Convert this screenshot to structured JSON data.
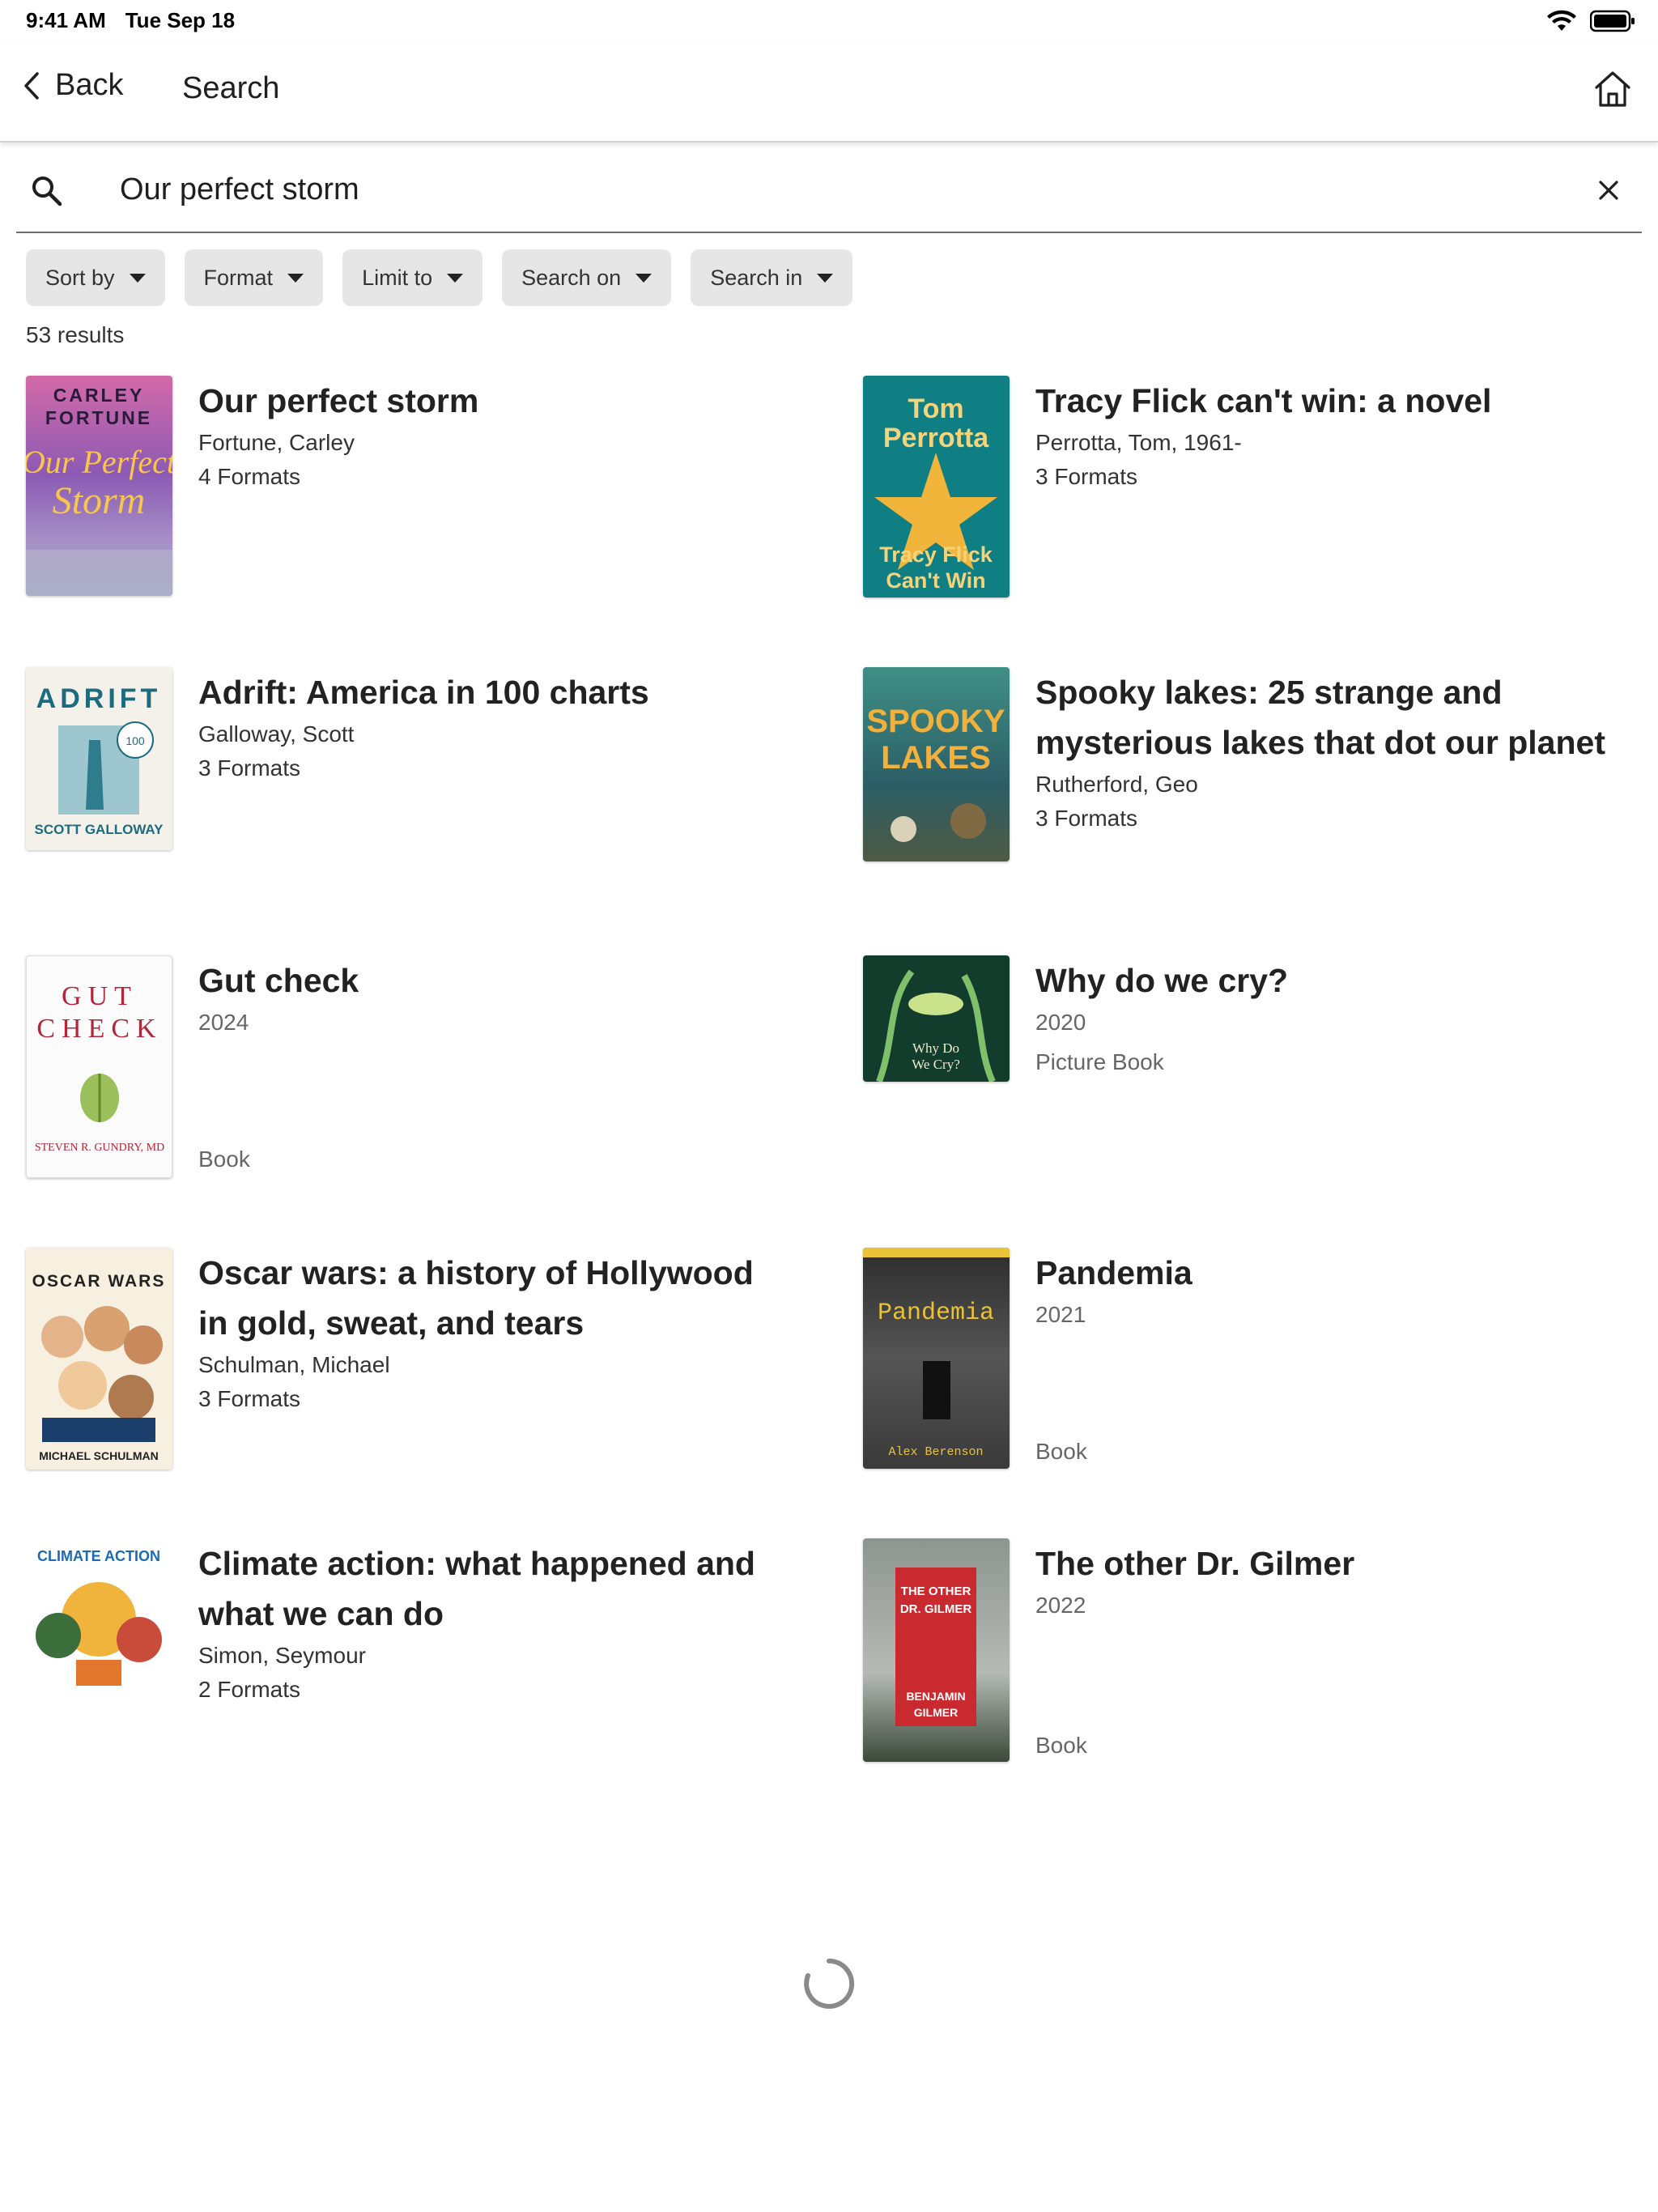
{
  "status": {
    "time": "9:41 AM",
    "date": "Tue Sep 18"
  },
  "nav": {
    "back_label": "Back",
    "title": "Search",
    "home_icon": "home-icon"
  },
  "search": {
    "value": "Our perfect storm",
    "placeholder": "",
    "search_icon": "search-icon",
    "clear_icon": "close-icon"
  },
  "filters": [
    {
      "label": "Sort by"
    },
    {
      "label": "Format"
    },
    {
      "label": "Limit to"
    },
    {
      "label": "Search on"
    },
    {
      "label": "Search in"
    }
  ],
  "results_count": "53 results",
  "results": [
    {
      "title": "Our perfect storm",
      "author": "Fortune, Carley",
      "formats": "4 Formats",
      "cover": {
        "bg": "#9a5fa0",
        "text_top": "CARLEY FORTUNE",
        "text_main": "Our Perfect Storm"
      }
    },
    {
      "title": "Tracy Flick can't win: a novel",
      "author": "Perrotta, Tom, 1961-",
      "formats": "3 Formats",
      "cover": {
        "bg": "#0f7f84",
        "text_top": "Tom Perrotta",
        "text_main": "Tracy Flick Can't Win"
      }
    },
    {
      "title": "Adrift: America in 100 charts",
      "author": "Galloway, Scott",
      "formats": "3 Formats",
      "cover": {
        "bg": "#f3f1ea",
        "text_top": "ADRIFT",
        "text_main": "SCOTT GALLOWAY"
      }
    },
    {
      "title": "Spooky lakes: 25 strange and mysterious lakes that dot our planet",
      "author": "Rutherford, Geo",
      "formats": "3 Formats",
      "cover": {
        "bg": "#2d6f6b",
        "text_top": "SPOOKY",
        "text_main": "LAKES"
      }
    },
    {
      "title": "Gut check",
      "year": "2024",
      "format": "Book",
      "cover": {
        "bg": "#fbfbfb",
        "text_top": "GUT",
        "text_main": "CHECK"
      }
    },
    {
      "title": "Why do we cry?",
      "year": "2020",
      "format": "Picture Book",
      "cover": {
        "bg": "#123c2c",
        "text_top": "",
        "text_main": "Why Do We Cry?"
      }
    },
    {
      "title": "Oscar wars: a history of Hollywood in gold, sweat, and tears",
      "author": "Schulman, Michael",
      "formats": "3 Formats",
      "cover": {
        "bg": "#f7efe0",
        "text_top": "OSCAR WARS",
        "text_main": "MICHAEL SCHULMAN"
      }
    },
    {
      "title": "Pandemia",
      "year": "2021",
      "format": "Book",
      "cover": {
        "bg": "#3a3a3a",
        "text_top": "Pandemia",
        "text_main": "Alex Berenson"
      }
    },
    {
      "title": "Climate action: what happened and what we can do",
      "author": "Simon, Seymour",
      "formats": "2 Formats",
      "cover": {
        "bg": "#ffffff",
        "text_top": "CLIMATE ACTION",
        "text_main": ""
      }
    },
    {
      "title": "The other Dr. Gilmer",
      "year": "2022",
      "format": "Book",
      "cover": {
        "bg": "#4b4e4c",
        "text_top": "THE OTHER DR. GILMER",
        "text_main": "BENJAMIN GILMER"
      }
    }
  ],
  "loading_icon": "spinner-icon"
}
